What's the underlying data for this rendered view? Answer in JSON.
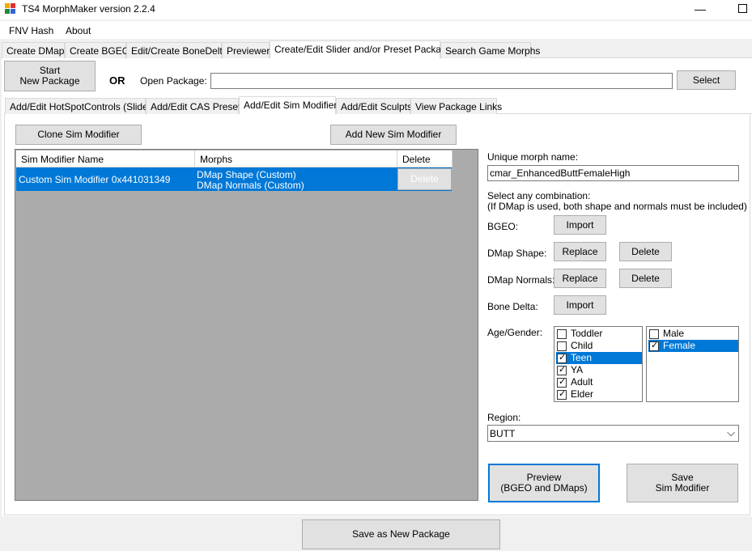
{
  "window": {
    "title": "TS4 MorphMaker version 2.2.4",
    "minimize": "—"
  },
  "menu": {
    "items": [
      "FNV Hash",
      "About"
    ]
  },
  "main_tabs": [
    "Create DMaps",
    "Create BGEO",
    "Edit/Create BoneDelta",
    "Previewer",
    "Create/Edit Slider and/or Preset Package",
    "Search Game Morphs"
  ],
  "package": {
    "start_label_1": "Start",
    "start_label_2": "New Package",
    "or_label": "OR",
    "open_label": "Open Package:",
    "open_value": "",
    "select_label": "Select"
  },
  "sub_tabs": [
    "Add/Edit HotSpotControls (Sliders)",
    "Add/Edit CAS Presets",
    "Add/Edit Sim Modifiers",
    "Add/Edit Sculpts",
    "View Package Links"
  ],
  "modifiers": {
    "clone_label": "Clone Sim Modifier",
    "add_label": "Add New Sim Modifier",
    "columns": [
      "Sim Modifier Name",
      "Morphs",
      "Delete"
    ],
    "rows": [
      {
        "name": "Custom Sim Modifier 0x441031349",
        "morph_1": "DMap Shape (Custom)",
        "morph_2": "DMap Normals (Custom)",
        "delete": "Delete"
      }
    ]
  },
  "details": {
    "unique_label": "Unique morph name:",
    "unique_value": "cmar_EnhancedButtFemaleHigh",
    "combo_line1": "Select any combination:",
    "combo_line2": "(If DMap is used, both shape and normals must be included)",
    "bgeo_label": "BGEO:",
    "import_label": "Import",
    "dmap_shape_label": "DMap Shape:",
    "dmap_normals_label": "DMap Normals:",
    "replace_label": "Replace",
    "delete_label": "Delete",
    "bone_delta_label": "Bone Delta:",
    "age_gender_label": "Age/Gender:",
    "ages": [
      {
        "label": "Toddler",
        "checked": ""
      },
      {
        "label": "Child",
        "checked": ""
      },
      {
        "label": "Teen",
        "checked": "✓"
      },
      {
        "label": "YA",
        "checked": "✓"
      },
      {
        "label": "Adult",
        "checked": "✓"
      },
      {
        "label": "Elder",
        "checked": "✓"
      }
    ],
    "genders": [
      {
        "label": "Male",
        "checked": ""
      },
      {
        "label": "Female",
        "checked": "✓"
      }
    ],
    "region_label": "Region:",
    "region_value": "BUTT",
    "dropdown_arrow": "⌵",
    "preview_line1": "Preview",
    "preview_line2": "(BGEO and DMaps)",
    "save_line1": "Save",
    "save_line2": "Sim Modifier"
  },
  "footer": {
    "save_package_label": "Save as New Package"
  },
  "colors": {
    "selection": "#0078d7",
    "grid_bg": "#ababab",
    "button": "#e1e1e1"
  }
}
